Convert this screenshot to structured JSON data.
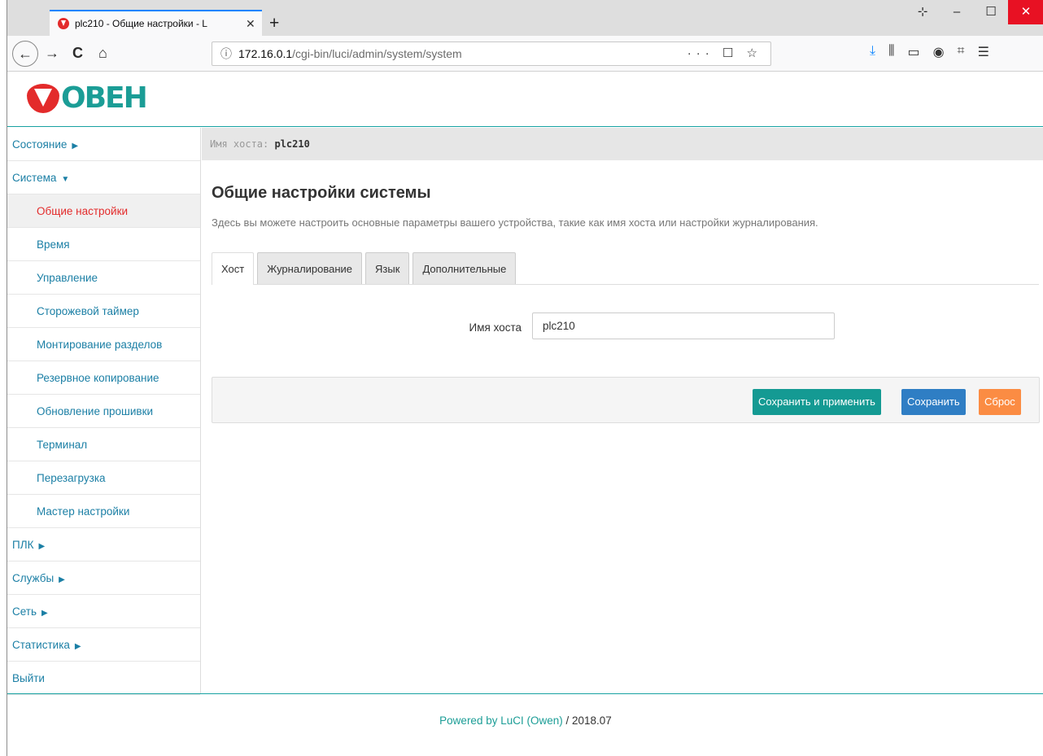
{
  "browser": {
    "tab_title": "plc210 - Общие настройки - L",
    "tab_close": "✕",
    "new_tab": "+",
    "url_host": "172.16.0.1",
    "url_path": "/cgi-bin/luci/admin/system/system",
    "url_actions": "··· ☐ ☆",
    "window_controls": [
      "⊹",
      "–",
      "☐",
      "✕"
    ]
  },
  "header": {
    "logo_text": "ОВЕН"
  },
  "hostbar": {
    "label": "Имя хоста: ",
    "value": "plc210"
  },
  "sidebar": {
    "items": [
      {
        "label": "Состояние",
        "arrow": "▶",
        "level": 0
      },
      {
        "label": "Система",
        "arrow": "▼",
        "level": 0
      },
      {
        "label": "Общие настройки",
        "level": 1,
        "active": true
      },
      {
        "label": "Время",
        "level": 1
      },
      {
        "label": "Управление",
        "level": 1
      },
      {
        "label": "Сторожевой таймер",
        "level": 1
      },
      {
        "label": "Монтирование разделов",
        "level": 1
      },
      {
        "label": "Резервное копирование",
        "level": 1
      },
      {
        "label": "Обновление прошивки",
        "level": 1
      },
      {
        "label": "Терминал",
        "level": 1
      },
      {
        "label": "Перезагрузка",
        "level": 1
      },
      {
        "label": "Мастер настройки",
        "level": 1
      },
      {
        "label": "ПЛК",
        "arrow": "▶",
        "level": 0
      },
      {
        "label": "Службы",
        "arrow": "▶",
        "level": 0
      },
      {
        "label": "Сеть",
        "arrow": "▶",
        "level": 0
      },
      {
        "label": "Статистика",
        "arrow": "▶",
        "level": 0
      },
      {
        "label": "Выйти",
        "level": 0
      }
    ]
  },
  "main": {
    "title": "Общие настройки системы",
    "description": "Здесь вы можете настроить основные параметры вашего устройства, такие как имя хоста или настройки журналирования.",
    "tabs": [
      "Хост",
      "Журналирование",
      "Язык",
      "Дополнительные"
    ],
    "hostname_label": "Имя хоста",
    "hostname_value": "plc210",
    "buttons": {
      "save_apply": "Сохранить и применить",
      "save": "Сохранить",
      "reset": "Сброс"
    }
  },
  "footer": {
    "link": "Powered by LuCI (Owen)",
    "suffix": " / 2018.07"
  },
  "colors": {
    "accent": "#1b9d96",
    "link": "#1b7fa5",
    "active": "#e32b2b",
    "save": "#2f7ec4",
    "reset": "#fb8c43"
  }
}
